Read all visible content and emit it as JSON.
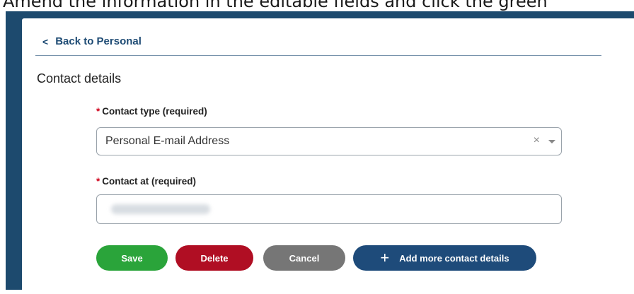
{
  "instruction": "Amend the information in the editable fields and click the green",
  "back_link": {
    "label": "Back to Personal",
    "icon": "chevron-left-icon"
  },
  "section_title": "Contact details",
  "contact_type": {
    "label": "Contact type  (required)",
    "required_marker": "*",
    "value": "Personal E-mail Address",
    "clear_symbol": "×"
  },
  "contact_at": {
    "label": "Contact at (required)",
    "required_marker": "*",
    "value": ""
  },
  "buttons": {
    "save": "Save",
    "delete": "Delete",
    "cancel": "Cancel",
    "add_more": "Add more contact details",
    "add_icon": "plus-icon"
  },
  "colors": {
    "backdrop": "#1d4a6e",
    "link": "#1e4b74",
    "save": "#2aa43a",
    "delete": "#b00e23",
    "cancel": "#767676",
    "add": "#1e4b7a",
    "required": "#d0021b"
  }
}
